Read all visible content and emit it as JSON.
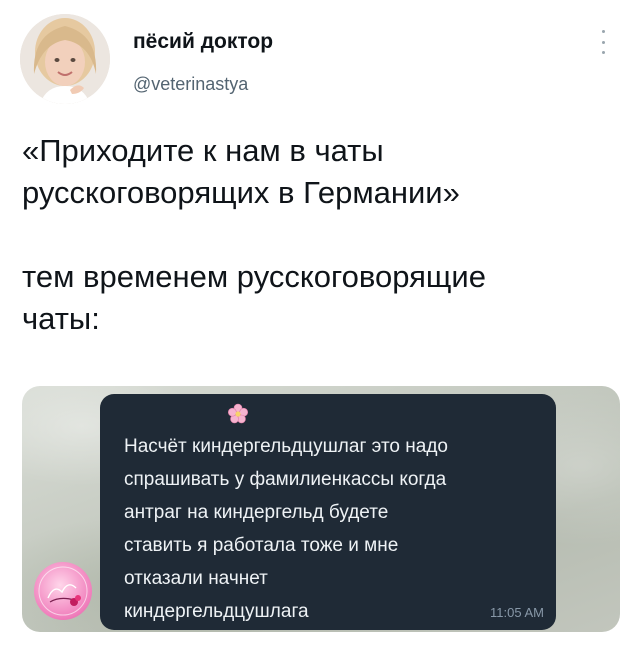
{
  "author": {
    "name": "пёсий доктор",
    "handle": "@veterinastya"
  },
  "tweet": {
    "text": "«Приходите к нам в чаты\nрусскоговорящих в Германии»\n\nтем временем русскоговорящие\nчаты:"
  },
  "media": {
    "message_text": "Насчёт киндергельдцушлаг это надо\nспрашивать у фамилиенкассы когда\nантраг на киндергельд будете\nставить я работала тоже и мне\nотказали начнет\nкиндергельдцушлага",
    "time": "11:05 AM",
    "flower_icon": "cherry-blossom-icon",
    "sticker_icon": "sticker-icon"
  },
  "colors": {
    "text": "#0f1419",
    "muted": "#536471",
    "bubble": "#1f2a36",
    "bubble_text": "#eef2f5",
    "bubble_time": "#8898a8"
  }
}
